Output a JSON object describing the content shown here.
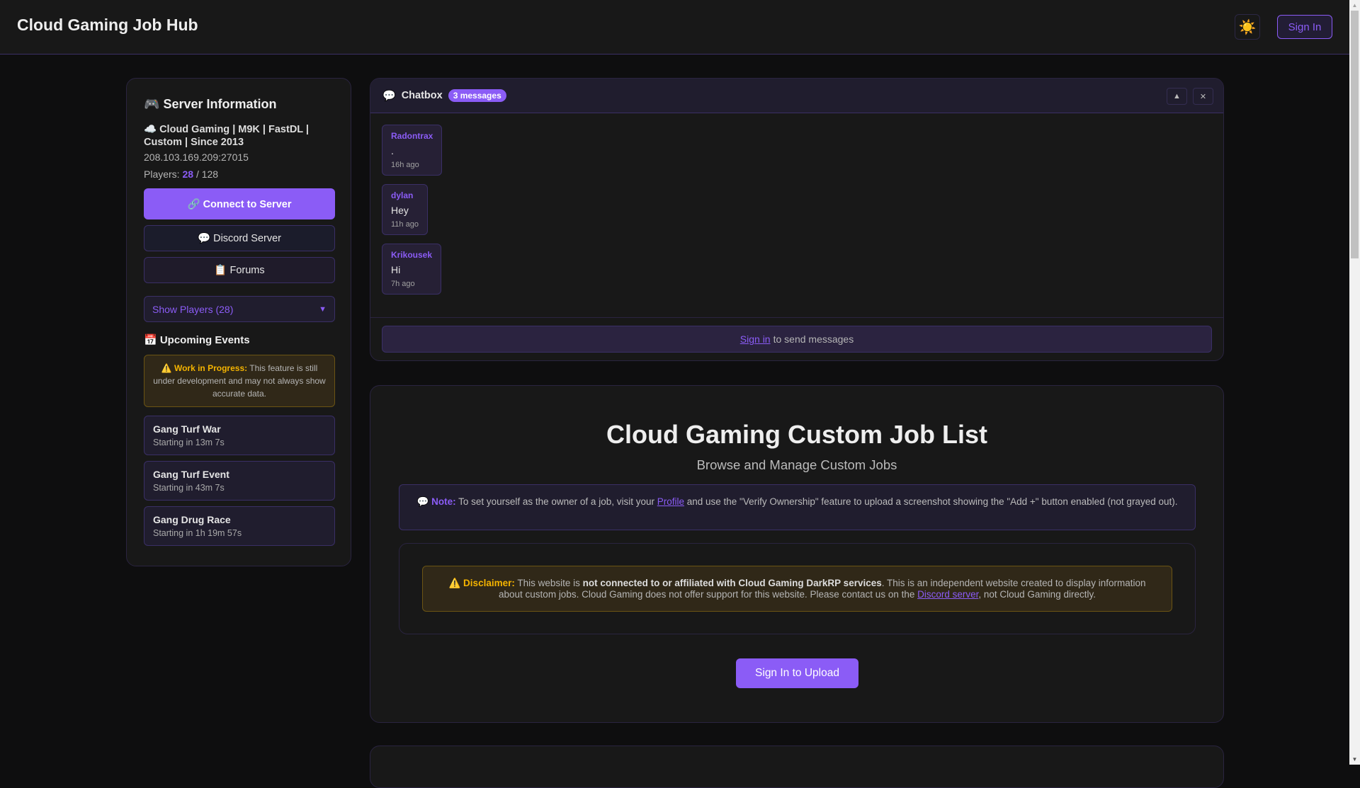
{
  "header": {
    "title": "Cloud Gaming Job Hub",
    "theme_icon": "☀️",
    "sign_in": "Sign In"
  },
  "server": {
    "heading_icon": "🎮",
    "heading": "Server Information",
    "name": "☁️ Cloud Gaming | M9K | FastDL | Custom | Since 2013",
    "address": "208.103.169.209:27015",
    "players_label": "Players:",
    "players_current": "28",
    "players_sep": "/",
    "players_max": "128",
    "connect": "🔗 Connect to Server",
    "discord": "💬 Discord Server",
    "forums": "📋 Forums",
    "show_players": "Show Players (28)",
    "show_players_caret": "▼"
  },
  "events": {
    "heading": "📅 Upcoming Events",
    "wip_label": "⚠️ Work in Progress:",
    "wip_text": " This feature is still under development and may not always show accurate data.",
    "items": [
      {
        "name": "Gang Turf War",
        "time": "Starting in 13m 7s"
      },
      {
        "name": "Gang Turf Event",
        "time": "Starting in 43m 7s"
      },
      {
        "name": "Gang Drug Race",
        "time": "Starting in 1h 19m 57s"
      }
    ]
  },
  "chat": {
    "icon": "💬",
    "title": "Chatbox",
    "badge": "3 messages",
    "collapse": "▲",
    "close": "✕",
    "messages": [
      {
        "user": "Radontrax",
        "text": ".",
        "time": "16h ago"
      },
      {
        "user": "dylan",
        "text": "Hey",
        "time": "11h ago"
      },
      {
        "user": "Krikousek",
        "text": "Hi",
        "time": "7h ago"
      }
    ],
    "signin_link": "Sign in",
    "signin_text": "to send messages"
  },
  "main": {
    "title": "Cloud Gaming Custom Job List",
    "subtitle": "Browse and Manage Custom Jobs",
    "note_label": "💬 Note:",
    "note_pre": " To set yourself as the owner of a job, visit your ",
    "note_link": "Profile",
    "note_post": " and use the \"Verify Ownership\" feature to upload a screenshot showing the \"Add +\" button enabled (not grayed out).",
    "disclaimer_label": "⚠️ Disclaimer:",
    "disclaimer_pre": " This website is ",
    "disclaimer_strong": "not connected to or affiliated with Cloud Gaming DarkRP services",
    "disclaimer_mid": ". This is an independent website created to display information about custom jobs. Cloud Gaming does not offer support for this website. Please contact us on the ",
    "disclaimer_link": "Discord server",
    "disclaimer_post": ", not Cloud Gaming directly.",
    "upload": "Sign In to Upload"
  },
  "colors": {
    "accent": "#8b5cf6",
    "warning": "#f5b400",
    "background": "#0e0e0f",
    "card": "#181818"
  }
}
